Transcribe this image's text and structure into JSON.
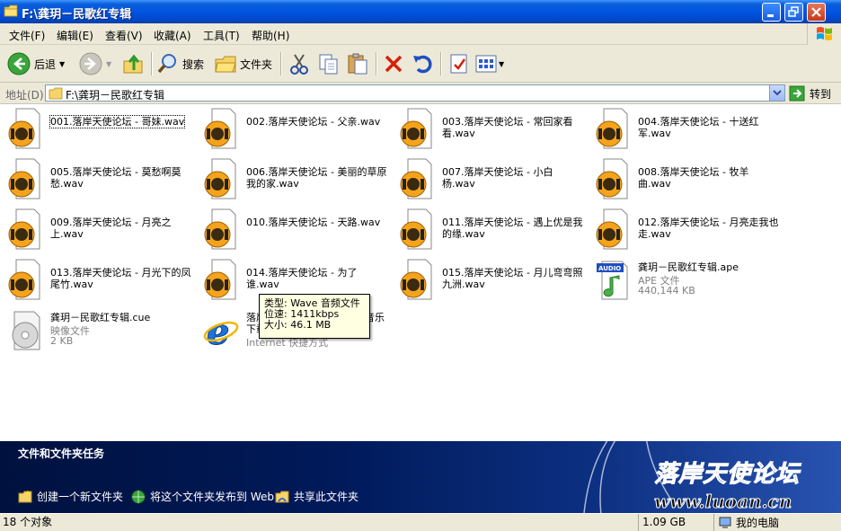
{
  "window": {
    "title": "F:\\龚玥－民歌红专辑"
  },
  "menu": {
    "items": [
      "文件(F)",
      "编辑(E)",
      "查看(V)",
      "收藏(A)",
      "工具(T)",
      "帮助(H)"
    ]
  },
  "toolbar": {
    "back_label": "后退",
    "search_label": "搜索",
    "folders_label": "文件夹"
  },
  "address": {
    "label": "地址(D)",
    "value": "F:\\龚玥－民歌红专辑",
    "go_label": "转到"
  },
  "files": [
    {
      "name": "001.落岸天使论坛 - 哥妹.wav",
      "type": "wav"
    },
    {
      "name": "002.落岸天使论坛 - 父亲.wav",
      "type": "wav"
    },
    {
      "name": "003.落岸天使论坛 - 常回家看看.wav",
      "type": "wav"
    },
    {
      "name": "004.落岸天使论坛 - 十送红军.wav",
      "type": "wav"
    },
    {
      "name": "005.落岸天使论坛 - 莫愁啊莫愁.wav",
      "type": "wav"
    },
    {
      "name": "006.落岸天使论坛 - 美丽的草原我的家.wav",
      "type": "wav"
    },
    {
      "name": "007.落岸天使论坛 - 小白杨.wav",
      "type": "wav"
    },
    {
      "name": "008.落岸天使论坛 - 牧羊曲.wav",
      "type": "wav"
    },
    {
      "name": "009.落岸天使论坛 - 月亮之上.wav",
      "type": "wav"
    },
    {
      "name": "010.落岸天使论坛 - 天路.wav",
      "type": "wav"
    },
    {
      "name": "011.落岸天使论坛 - 遇上优是我的缘.wav",
      "type": "wav"
    },
    {
      "name": "012.落岸天使论坛 - 月亮走我也走.wav",
      "type": "wav"
    },
    {
      "name": "013.落岸天使论坛 - 月光下的凤尾竹.wav",
      "type": "wav"
    },
    {
      "name": "014.落岸天使论坛 - 为了谁.wav",
      "type": "wav"
    },
    {
      "name": "015.落岸天使论坛 - 月儿弯弯照九洲.wav",
      "type": "wav"
    },
    {
      "name": "龚玥－民歌红专辑.ape",
      "type": "ape",
      "kind": "APE 文件",
      "size": "440,144 KB",
      "badge": "AUDIO"
    },
    {
      "name": "龚玥－民歌红专辑.cue",
      "type": "cue",
      "kind": "映像文件",
      "size": "2 KB"
    },
    {
      "name": "落岸天使论坛－提供高音质音乐下载",
      "type": "url",
      "kind": "Internet 快捷方式"
    }
  ],
  "tooltip": {
    "type_line": "类型: Wave 音频文件",
    "rate_line": "位速: 1411kbps",
    "size_line": "大小: 46.1 MB"
  },
  "tasks": {
    "title": "文件和文件夹任务",
    "links": [
      "创建一个新文件夹",
      "将这个文件夹发布到 Web",
      "共享此文件夹"
    ]
  },
  "watermark": {
    "line1": "落岸天使论坛",
    "line2": "www.luoan.cn"
  },
  "status": {
    "count": "18 个对象",
    "size": "1.09 GB",
    "location": "我的电脑"
  },
  "colors": {
    "title_blue": "#0054e3",
    "panel_dark": "#001a5a",
    "tooltip_bg": "#ffffe1"
  }
}
